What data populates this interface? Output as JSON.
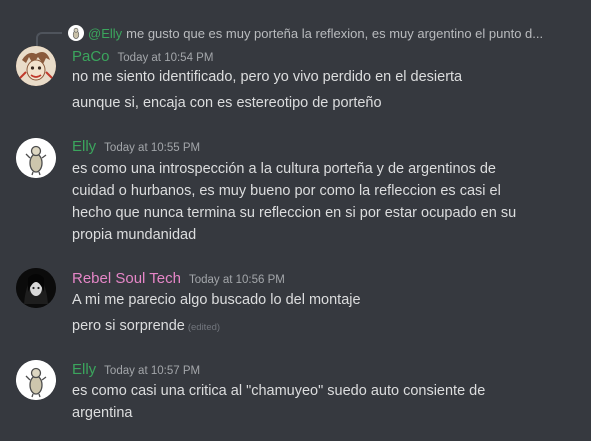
{
  "reply": {
    "author": "@Elly",
    "text": "me gusto que es muy porteña la reflexion, es muy argentino el punto d..."
  },
  "messages": [
    {
      "username": "PaCo",
      "username_color": "#3ba55d",
      "timestamp": "Today at 10:54 PM",
      "lines": [
        "no me siento identificado, pero yo vivo perdido en el desierta",
        "aunque si, encaja con es estereotipo de porteño"
      ]
    },
    {
      "username": "Elly",
      "username_color": "#3ba55d",
      "timestamp": "Today at 10:55 PM",
      "lines": [
        "es como una introspección a la cultura porteña y de argentinos de",
        "cuidad o hurbanos, es muy bueno por como la refleccion es casi el",
        "hecho que nunca termina su refleccion en si por estar ocupado en su",
        "propia mundanidad"
      ]
    },
    {
      "username": "Rebel Soul Tech",
      "username_color": "#e586c7",
      "timestamp": "Today at 10:56 PM",
      "lines": [
        "A mi me parecio algo  buscado lo del montaje",
        "pero si sorprende"
      ],
      "edited_label": "(edited)"
    },
    {
      "username": "Elly",
      "username_color": "#3ba55d",
      "timestamp": "Today at 10:57 PM",
      "lines": [
        "es como casi una critica al \"chamuyeo\" suedo auto consiente de",
        "argentina"
      ]
    }
  ]
}
